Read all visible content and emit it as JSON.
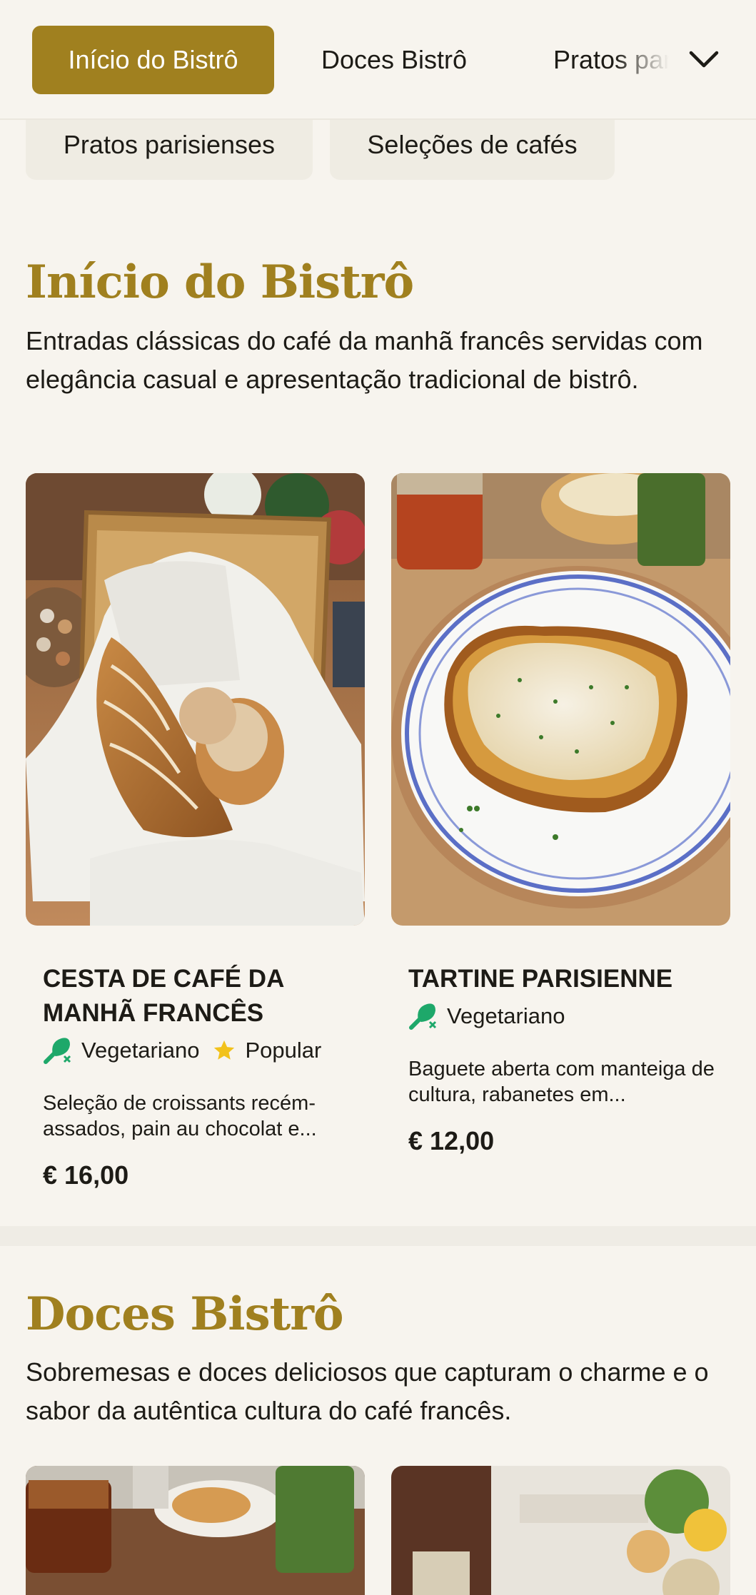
{
  "nav": {
    "tabs": [
      {
        "label": "Início do Bistrô",
        "active": true
      },
      {
        "label": "Doces Bistrô",
        "active": false
      },
      {
        "label": "Pratos parisienses",
        "active": false
      }
    ],
    "expand_icon": "chevron-down-icon",
    "chips": [
      {
        "label": "Pratos parisienses"
      },
      {
        "label": "Seleções de cafés"
      }
    ]
  },
  "colors": {
    "accent": "#a0801f",
    "background": "#f7f4ee",
    "veg_icon": "#1ea86a",
    "star": "#f2c21b"
  },
  "sections": [
    {
      "title": "Início do Bistrô",
      "description": "Entradas clássicas do café da manhã francês servidas com elegância casual e apresentação tradicional de bistrô.",
      "items": [
        {
          "name": "CESTA DE CAFÉ DA MANHÃ FRANCÊS",
          "badges": [
            {
              "icon": "vegetarian-icon",
              "label": "Vegetariano"
            },
            {
              "icon": "star-icon",
              "label": "Popular"
            }
          ],
          "description": "Seleção de croissants recém-assados, pain au chocolat e...",
          "price": "€ 16,00",
          "image": "pastry-basket-photo"
        },
        {
          "name": "TARTINE PARISIENNE",
          "badges": [
            {
              "icon": "vegetarian-icon",
              "label": "Vegetariano"
            }
          ],
          "description": "Baguete aberta com manteiga de cultura, rabanetes em...",
          "price": "€ 12,00",
          "image": "tartine-plate-photo"
        }
      ]
    },
    {
      "title": "Doces Bistrô",
      "description": "Sobremesas e doces deliciosos que capturam o charme e o sabor da autêntica cultura do café francês.",
      "items": [
        {
          "image": "bistro-table-photo"
        },
        {
          "image": "bottle-flowers-photo"
        }
      ]
    }
  ]
}
